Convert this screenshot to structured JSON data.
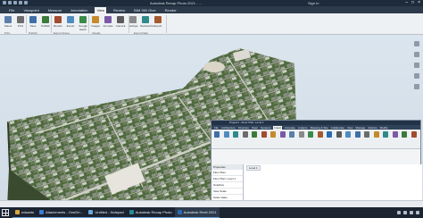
{
  "app": {
    "title": "Autodesk Recap Photo 2021 - …",
    "sign_in": "Sign In"
  },
  "tabs": [
    "File",
    "Viewpoint",
    "Measure",
    "Annotation",
    "View",
    "Review",
    "BIM 360 Glue",
    "Render"
  ],
  "active_tab_index": 4,
  "ribbon": {
    "buttons": [
      {
        "label": "Select",
        "color": "#5b7fa8"
      },
      {
        "label": "Print",
        "color": "#6b6b6b"
      },
      {
        "label": "Save",
        "color": "#3f6fa6"
      },
      {
        "label": "Publish",
        "color": "#3a7a3a"
      },
      {
        "label": "Render",
        "color": "#a34b2f"
      },
      {
        "label": "Export",
        "color": "#4f8bc0"
      },
      {
        "label": "Google Earth",
        "color": "#3a8a4a"
      },
      {
        "label": "Images",
        "color": "#c48a2b"
      },
      {
        "label": "Animate",
        "color": "#7a5aa5"
      },
      {
        "label": "Camera",
        "color": "#5a5a5a"
      },
      {
        "label": "Settings",
        "color": "#8a8a8a"
      },
      {
        "label": "Navisworks",
        "color": "#2f8a8a"
      },
      {
        "label": "Export",
        "color": "#a35a2f"
      }
    ],
    "panels": [
      "Print",
      "Publish",
      "Export Scene",
      "Visuals",
      "Export Data"
    ]
  },
  "revit_window": {
    "title": "Project1 - Floor Plan: Level 1",
    "tabs": [
      "File",
      "Architecture",
      "Structure",
      "Steel",
      "Systems",
      "Insert",
      "Annotate",
      "Analyze",
      "Massing & Site",
      "Collaborate",
      "View",
      "Manage",
      "Add-Ins",
      "Modify"
    ],
    "active_tab_index": 5,
    "properties_header": "Properties",
    "properties_rows": [
      "Floor Plan",
      "Floor Plan: Level 1",
      "Graphics",
      "View Scale",
      "Scale Value",
      "Display Model"
    ],
    "view_tab": "Level 1"
  },
  "taskbar": {
    "items": [
      {
        "label": "edwarts",
        "color": "#d9a63b"
      },
      {
        "label": "Attachments - OneDri…",
        "color": "#3b7dd8"
      },
      {
        "label": "Untitled - Notepad",
        "color": "#6ea6d8"
      },
      {
        "label": "Autodesk Recap Photo",
        "color": "#2a8a9a"
      },
      {
        "label": "Autodesk Revit 2021",
        "color": "#2a6ab0"
      }
    ],
    "active_index": 4
  }
}
